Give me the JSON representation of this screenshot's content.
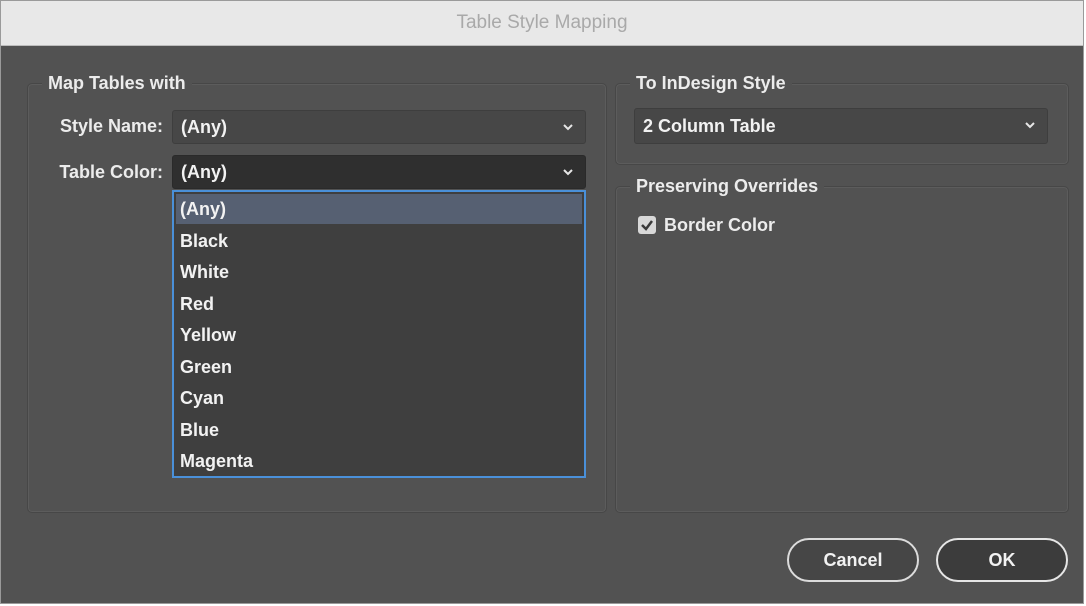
{
  "window": {
    "title": "Table Style Mapping"
  },
  "map_group": {
    "title": "Map Tables with",
    "style_name_label": "Style Name:",
    "style_name_value": "(Any)",
    "table_color_label": "Table Color:",
    "table_color_value": "(Any)"
  },
  "dropdown": {
    "options": [
      "(Any)",
      "Black",
      "White",
      "Red",
      "Yellow",
      "Green",
      "Cyan",
      "Blue",
      "Magenta"
    ],
    "highlighted": "(Any)"
  },
  "style_group": {
    "title": "To InDesign Style",
    "value": "2 Column Table"
  },
  "overrides_group": {
    "title": "Preserving Overrides",
    "border_color_label": "Border Color",
    "border_color_checked": true
  },
  "buttons": {
    "cancel": "Cancel",
    "ok": "OK"
  }
}
